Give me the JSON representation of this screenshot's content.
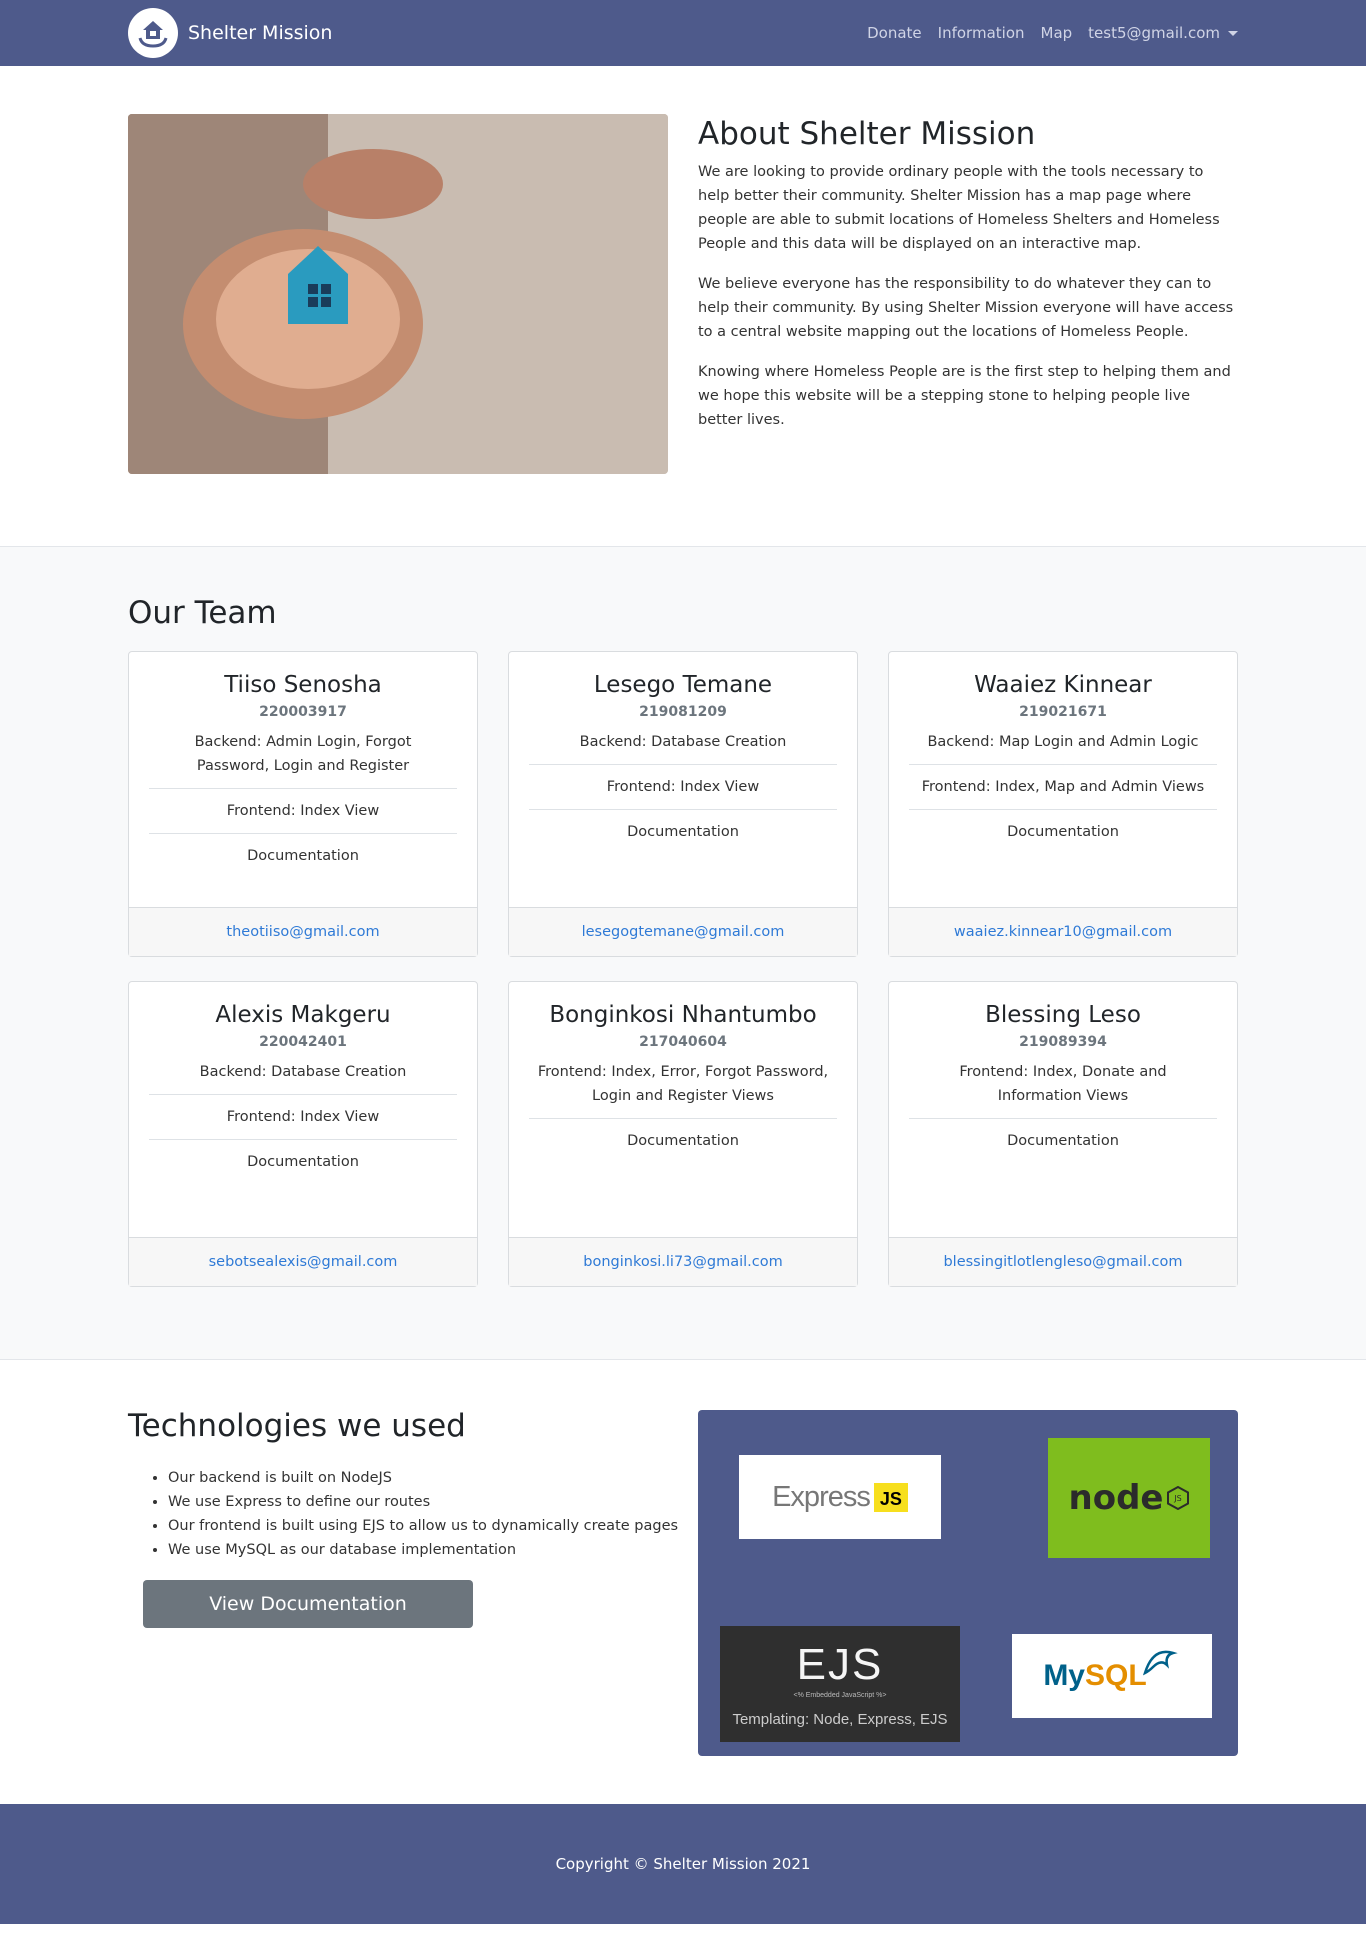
{
  "navbar": {
    "brand": "Shelter Mission",
    "links": [
      "Donate",
      "Information",
      "Map"
    ],
    "user": "test5@gmail.com"
  },
  "about": {
    "title": "About Shelter Mission",
    "paragraphs": [
      "We are looking to provide ordinary people with the tools necessary to help better their community. Shelter Mission has a map page where people are able to submit locations of Homeless Shelters and Homeless People and this data will be displayed on an interactive map.",
      "We believe everyone has the responsibility to do whatever they can to help their community. By using Shelter Mission everyone will have access to a central website mapping out the locations of Homeless People.",
      "Knowing where Homeless People are is the first step to helping them and we hope this website will be a stepping stone to helping people live better lives."
    ]
  },
  "team": {
    "title": "Our Team",
    "members": [
      {
        "name": "Tiiso Senosha",
        "id": "220003917",
        "items": [
          "Backend: Admin Login, Forgot Password, Login and Register",
          "Frontend: Index View",
          "Documentation"
        ],
        "email": "theotiiso@gmail.com"
      },
      {
        "name": "Lesego Temane",
        "id": "219081209",
        "items": [
          "Backend: Database Creation",
          "Frontend: Index View",
          "Documentation"
        ],
        "email": "lesegogtemane@gmail.com"
      },
      {
        "name": "Waaiez Kinnear",
        "id": "219021671",
        "items": [
          "Backend: Map Login and Admin Logic",
          "Frontend: Index, Map and Admin Views",
          "Documentation"
        ],
        "email": "waaiez.kinnear10@gmail.com"
      },
      {
        "name": "Alexis Makgeru",
        "id": "220042401",
        "items": [
          "Backend: Database Creation",
          "Frontend: Index View",
          "Documentation"
        ],
        "email": "sebotsealexis@gmail.com"
      },
      {
        "name": "Bonginkosi Nhantumbo",
        "id": "217040604",
        "items": [
          "Frontend: Index, Error, Forgot Password, Login and Register Views",
          "Documentation"
        ],
        "email": "bonginkosi.li73@gmail.com"
      },
      {
        "name": "Blessing Leso",
        "id": "219089394",
        "items": [
          "Frontend: Index, Donate and Information Views",
          "Documentation"
        ],
        "email": "blessingitlotlengleso@gmail.com"
      }
    ]
  },
  "tech": {
    "title": "Technologies we used",
    "items": [
      "Our backend is built on NodeJS",
      "We use Express to define our routes",
      "Our frontend is built using EJS to allow us to dynamically create pages",
      "We use MySQL as our database implementation"
    ],
    "button": "View Documentation",
    "logos": {
      "express": "Express",
      "express_js": "JS",
      "node": "node",
      "ejs": "EJS",
      "ejs_sub": "<% Embedded JavaScript %>",
      "ejs_caption": "Templating: Node, Express, EJS",
      "mysql_my": "My",
      "mysql_sql": "SQL"
    }
  },
  "footer": {
    "copyright": "Copyright © Shelter Mission 2021"
  }
}
